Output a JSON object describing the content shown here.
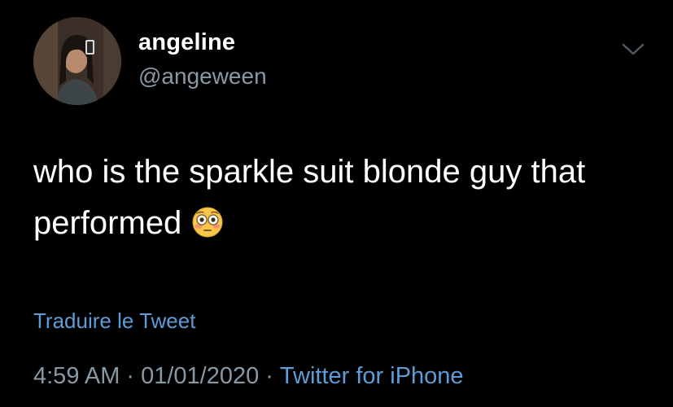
{
  "author": {
    "display_name": "angeline",
    "handle": "@angeween"
  },
  "tweet": {
    "text": "who is the sparkle suit blonde guy that performed",
    "emoji": "flushed-face"
  },
  "translate_label": "Traduire le Tweet",
  "meta": {
    "time": "4:59 AM",
    "separator": "·",
    "date": "01/01/2020",
    "source": "Twitter for iPhone"
  },
  "colors": {
    "background": "#000000",
    "text": "#ffffff",
    "secondary": "#8899a6",
    "link": "#5c9dd8"
  }
}
